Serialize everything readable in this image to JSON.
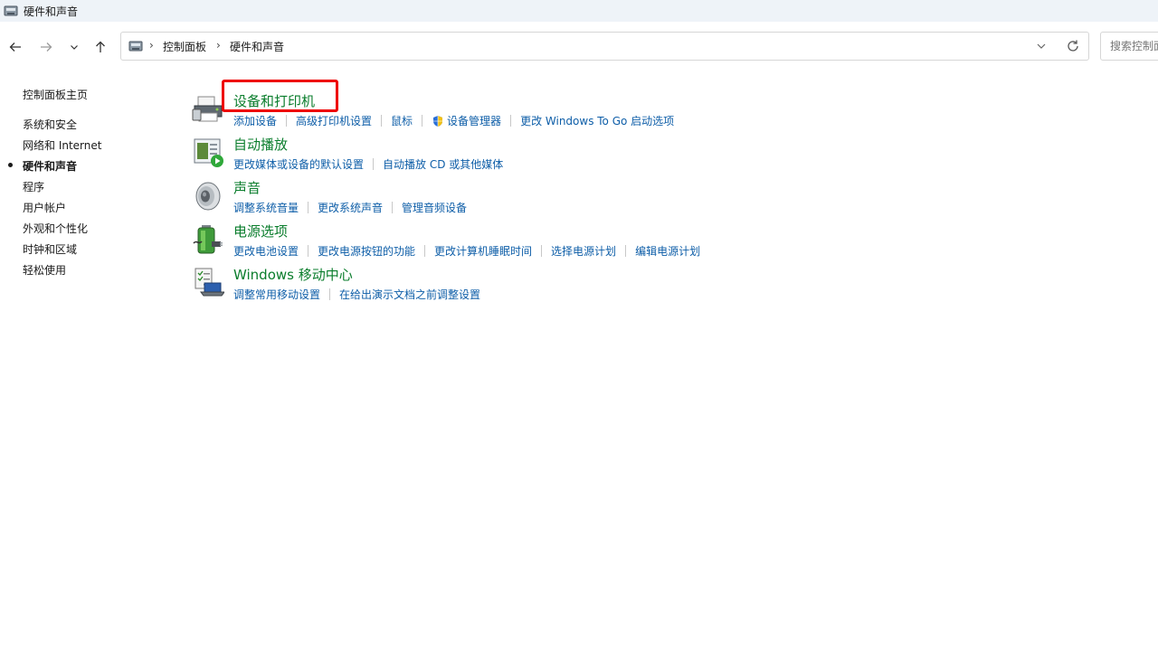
{
  "window": {
    "title": "硬件和声音",
    "icon": "control-panel-icon"
  },
  "nav": {
    "back_icon": "arrow-left-icon",
    "forward_icon": "arrow-right-icon",
    "recent_icon": "chevron-down-icon",
    "up_icon": "arrow-up-icon"
  },
  "address": {
    "icon": "control-panel-icon",
    "crumbs": [
      "控制面板",
      "硬件和声音"
    ],
    "dropdown_icon": "chevron-down-icon",
    "refresh_icon": "refresh-icon"
  },
  "search": {
    "placeholder": "搜索控制面板"
  },
  "sidebar": {
    "items": [
      {
        "label": "控制面板主页"
      },
      {
        "label": "系统和安全"
      },
      {
        "label": "网络和 Internet"
      },
      {
        "label": "硬件和声音",
        "active": true
      },
      {
        "label": "程序"
      },
      {
        "label": "用户帐户"
      },
      {
        "label": "外观和个性化"
      },
      {
        "label": "时钟和区域"
      },
      {
        "label": "轻松使用"
      }
    ]
  },
  "categories": [
    {
      "title": "设备和打印机",
      "icon": "printer-icon",
      "links": [
        "添加设备",
        "高级打印机设置",
        "鼠标",
        "设备管理器",
        "更改 Windows To Go 启动选项"
      ]
    },
    {
      "title": "自动播放",
      "icon": "autoplay-icon",
      "links": [
        "更改媒体或设备的默认设置",
        "自动播放 CD 或其他媒体"
      ]
    },
    {
      "title": "声音",
      "icon": "speaker-icon",
      "links": [
        "调整系统音量",
        "更改系统声音",
        "管理音频设备"
      ]
    },
    {
      "title": "电源选项",
      "icon": "battery-icon",
      "links": [
        "更改电池设置",
        "更改电源按钮的功能",
        "更改计算机睡眠时间",
        "选择电源计划",
        "编辑电源计划"
      ]
    },
    {
      "title": "Windows 移动中心",
      "icon": "laptop-icon",
      "links": [
        "调整常用移动设置",
        "在给出演示文档之前调整设置"
      ]
    }
  ],
  "colors": {
    "category_title": "#0a7d2c",
    "link": "#0e5ea8",
    "highlight": "#ee0000"
  }
}
